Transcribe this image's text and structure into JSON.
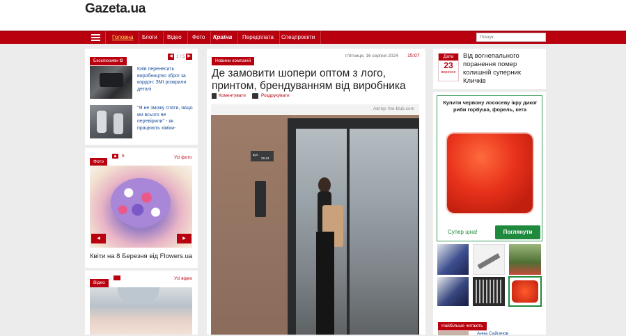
{
  "site": {
    "logo": "Gazeta.ua"
  },
  "nav": {
    "items": [
      "Головна",
      "Блоги",
      "Відео",
      "Фото",
      "Країна",
      "Передплата",
      "Спецпроєкти"
    ],
    "search_placeholder": "Пошук"
  },
  "exclusive": {
    "label": "Ексклюзиви",
    "label_badge": "G",
    "page": "1",
    "page_sep": "/",
    "page_total": "5",
    "items": [
      {
        "text": "Київ перенесить виробництво зброї за кордон: ЗМІ розкрили деталі"
      },
      {
        "text": "\"Я не зможу спати, якщо ми всього не перевірили\" - як працюють хіміки-"
      }
    ]
  },
  "photo": {
    "label": "Фото",
    "count": "5",
    "all_link": "Усі фото",
    "caption": "Квіти на 8 Березня від Flowers.ua"
  },
  "video": {
    "label": "Відео",
    "all_link": "Усі відео"
  },
  "article": {
    "category": "Новини компаній",
    "date": "п'ятниця, 16 серпня 2024",
    "time": "15:07",
    "title": "Де замовити шопери оптом з лого, принтом, брендуванням від виробника",
    "comment_label": "Коментувати",
    "print_label": "Роздрукувати",
    "author": "Автор: the-blub.com",
    "plate": {
      "line1": "вул.",
      "line2": "29-24"
    }
  },
  "date_card": {
    "label": "Дата",
    "day": "23",
    "month": "вересня",
    "text": "Від вогнепального поранення помер колишній суперник Кличків"
  },
  "ad": {
    "title": "Купити червону лососеву ікру дикої риби горбуша, форель, кета",
    "price_label": "Супер ціна!",
    "button": "Поглянути"
  },
  "most_read": {
    "label": "Найбільше читають",
    "author_fragment": "Анна Сайгачов"
  },
  "colors": {
    "brand": "#b8000f",
    "link": "#1a4f9c",
    "green": "#1f8a3d"
  }
}
